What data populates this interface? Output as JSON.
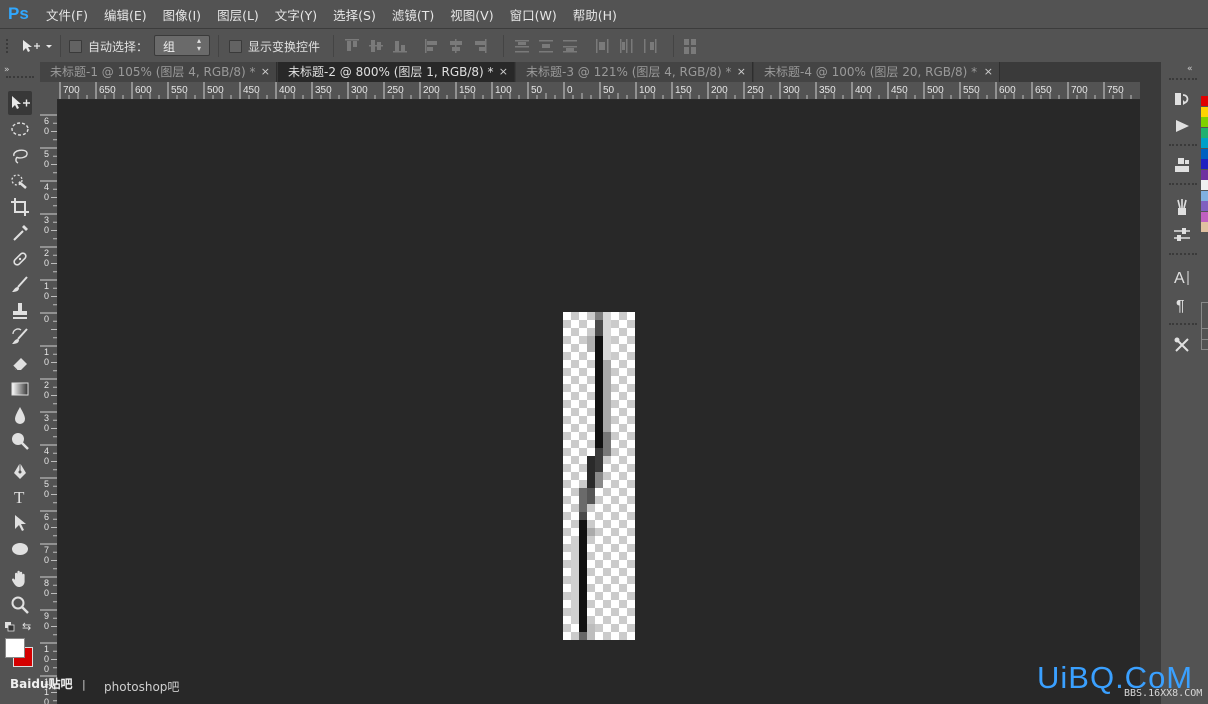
{
  "app": {
    "logo": "Ps"
  },
  "menu": [
    "文件(F)",
    "编辑(E)",
    "图像(I)",
    "图层(L)",
    "文字(Y)",
    "选择(S)",
    "滤镜(T)",
    "视图(V)",
    "窗口(W)",
    "帮助(H)"
  ],
  "options": {
    "auto_select_label": "自动选择：",
    "auto_select_value": "组",
    "show_transform_label": "显示变换控件"
  },
  "tabs": [
    {
      "label": "未标题-1 @ 105% (图层 4, RGB/8) *",
      "close": "×",
      "active": false
    },
    {
      "label": "未标题-2 @ 800% (图层 1, RGB/8) *",
      "close": "×",
      "active": true
    },
    {
      "label": "未标题-3 @ 121% (图层 4, RGB/8) *",
      "close": "×",
      "active": false
    },
    {
      "label": "未标题-4 @ 100% (图层 20, RGB/8) *",
      "close": "×",
      "active": false
    }
  ],
  "ruler": {
    "horizontal": [
      "700",
      "650",
      "600",
      "550",
      "500",
      "450",
      "400",
      "350",
      "300",
      "250",
      "200",
      "150",
      "100",
      "50",
      "0",
      "50",
      "100",
      "150",
      "200",
      "250",
      "300",
      "350",
      "400",
      "450",
      "500",
      "550",
      "600",
      "650",
      "700",
      "750"
    ],
    "vertical": [
      "6 0",
      "5 0",
      "4 0",
      "3 0",
      "2 0",
      "1 0",
      "0",
      "1 0",
      "2 0",
      "3 0",
      "4 0",
      "5 0",
      "6 0",
      "7 0",
      "8 0",
      "9 0",
      "1 0 0",
      "1 1 0"
    ]
  },
  "toolbox": [
    "move-icon",
    "marquee-icon",
    "lasso-icon",
    "quick-select-icon",
    "crop-icon",
    "eyedropper-icon",
    "healing-icon",
    "brush-icon",
    "stamp-icon",
    "history-brush-icon",
    "eraser-icon",
    "gradient-icon",
    "blur-icon",
    "dodge-icon",
    "pen-icon",
    "type-icon",
    "path-select-icon",
    "ellipse-icon",
    "hand-icon",
    "zoom-icon"
  ],
  "colors": {
    "foreground": "#ffffff",
    "background": "#d40000",
    "accent": "#31a8ff"
  },
  "swatches": [
    "#e00000",
    "#ffd400",
    "#7fd100",
    "#20b070",
    "#00a0c8",
    "#0060c0",
    "#2020c0",
    "#7030a0",
    "#f0f0f0",
    "#80b0e0",
    "#8060c0",
    "#c060c0",
    "#e0c0a0"
  ],
  "status": {
    "text": "photoshop吧"
  },
  "watermarks": {
    "left": "Baidu贴吧",
    "right": "UiBQ.CoM",
    "small": "BBS.16XX8.COM"
  }
}
